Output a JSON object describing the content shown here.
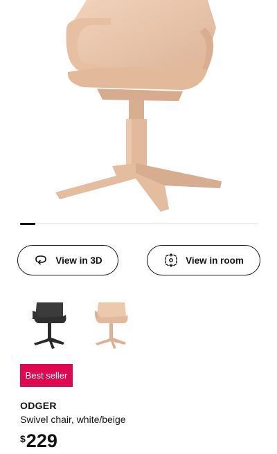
{
  "gallery": {
    "image": "chair-photo",
    "thumbnails": [
      "black-chair",
      "beige-chair"
    ]
  },
  "actions": {
    "view_3d_label": "View in 3D",
    "view_3d_icon": "rotate-icon",
    "view_room_label": "View in room",
    "view_room_icon": "ar-icon"
  },
  "product": {
    "badge": "Best seller",
    "name": "ODGER",
    "description": "Swivel chair, white/beige",
    "currency": "$",
    "price": "229"
  },
  "colors": {
    "badge_bg": "#e00751",
    "chair_beige": "#e9c6ab",
    "chair_black": "#3b3b3b"
  }
}
